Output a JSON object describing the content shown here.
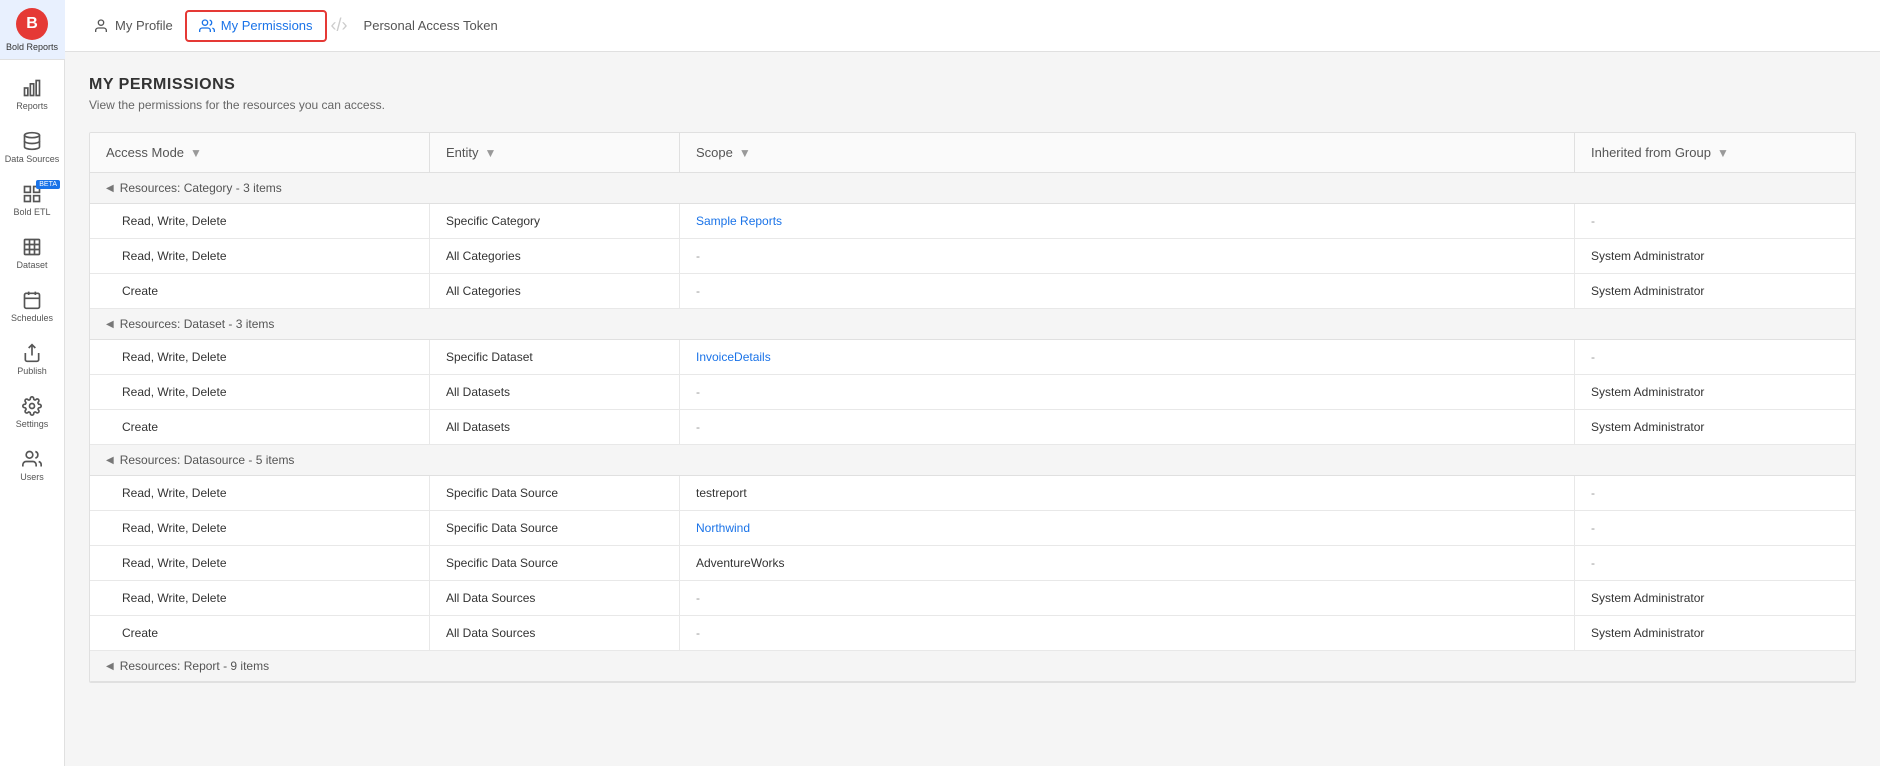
{
  "app": {
    "name": "Bold Reports"
  },
  "sidebar": {
    "items": [
      {
        "id": "reports",
        "label": "Reports",
        "icon": "chart-bar"
      },
      {
        "id": "datasources",
        "label": "Data Sources",
        "icon": "database"
      },
      {
        "id": "boldetl",
        "label": "Bold ETL",
        "icon": "etl",
        "badge": "BETA"
      },
      {
        "id": "dataset",
        "label": "Dataset",
        "icon": "grid"
      },
      {
        "id": "schedules",
        "label": "Schedules",
        "icon": "calendar"
      },
      {
        "id": "publish",
        "label": "Publish",
        "icon": "publish"
      },
      {
        "id": "settings",
        "label": "Settings",
        "icon": "settings"
      },
      {
        "id": "users",
        "label": "Users",
        "icon": "users"
      }
    ],
    "bottomItems": [
      {
        "id": "notifications",
        "label": "",
        "icon": "bell"
      }
    ]
  },
  "topNav": {
    "items": [
      {
        "id": "my-profile",
        "label": "My Profile",
        "icon": "user",
        "active": false
      },
      {
        "id": "my-permissions",
        "label": "My Permissions",
        "icon": "permissions",
        "active": true
      },
      {
        "id": "personal-access-token",
        "label": "Personal Access Token",
        "icon": "code",
        "active": false
      }
    ]
  },
  "page": {
    "title": "MY PERMISSIONS",
    "subtitle": "View the permissions for the resources you can access."
  },
  "table": {
    "columns": [
      {
        "id": "access-mode",
        "label": "Access Mode",
        "filterable": true
      },
      {
        "id": "entity",
        "label": "Entity",
        "filterable": true
      },
      {
        "id": "scope",
        "label": "Scope",
        "filterable": true
      },
      {
        "id": "inherited-from-group",
        "label": "Inherited from Group",
        "filterable": true
      }
    ],
    "groups": [
      {
        "id": "category",
        "label": "Resources: Category - 3 items",
        "rows": [
          {
            "accessMode": "Read, Write, Delete",
            "entity": "Specific Category",
            "scope": "Sample Reports",
            "scopeLink": true,
            "inheritedFromGroup": "-"
          },
          {
            "accessMode": "Read, Write, Delete",
            "entity": "All Categories",
            "scope": "-",
            "scopeLink": false,
            "inheritedFromGroup": "System Administrator"
          },
          {
            "accessMode": "Create",
            "entity": "All Categories",
            "scope": "-",
            "scopeLink": false,
            "inheritedFromGroup": "System Administrator"
          }
        ]
      },
      {
        "id": "dataset",
        "label": "Resources: Dataset - 3 items",
        "rows": [
          {
            "accessMode": "Read, Write, Delete",
            "entity": "Specific Dataset",
            "scope": "InvoiceDetails",
            "scopeLink": true,
            "inheritedFromGroup": "-"
          },
          {
            "accessMode": "Read, Write, Delete",
            "entity": "All Datasets",
            "scope": "-",
            "scopeLink": false,
            "inheritedFromGroup": "System Administrator"
          },
          {
            "accessMode": "Create",
            "entity": "All Datasets",
            "scope": "-",
            "scopeLink": false,
            "inheritedFromGroup": "System Administrator"
          }
        ]
      },
      {
        "id": "datasource",
        "label": "Resources: Datasource - 5 items",
        "rows": [
          {
            "accessMode": "Read, Write, Delete",
            "entity": "Specific Data Source",
            "scope": "testreport",
            "scopeLink": false,
            "inheritedFromGroup": "-"
          },
          {
            "accessMode": "Read, Write, Delete",
            "entity": "Specific Data Source",
            "scope": "Northwind",
            "scopeLink": true,
            "inheritedFromGroup": "-"
          },
          {
            "accessMode": "Read, Write, Delete",
            "entity": "Specific Data Source",
            "scope": "AdventureWorks",
            "scopeLink": false,
            "inheritedFromGroup": "-"
          },
          {
            "accessMode": "Read, Write, Delete",
            "entity": "All Data Sources",
            "scope": "-",
            "scopeLink": false,
            "inheritedFromGroup": "System Administrator"
          },
          {
            "accessMode": "Create",
            "entity": "All Data Sources",
            "scope": "-",
            "scopeLink": false,
            "inheritedFromGroup": "System Administrator"
          }
        ]
      },
      {
        "id": "report",
        "label": "Resources: Report - 9 items",
        "rows": []
      }
    ]
  }
}
